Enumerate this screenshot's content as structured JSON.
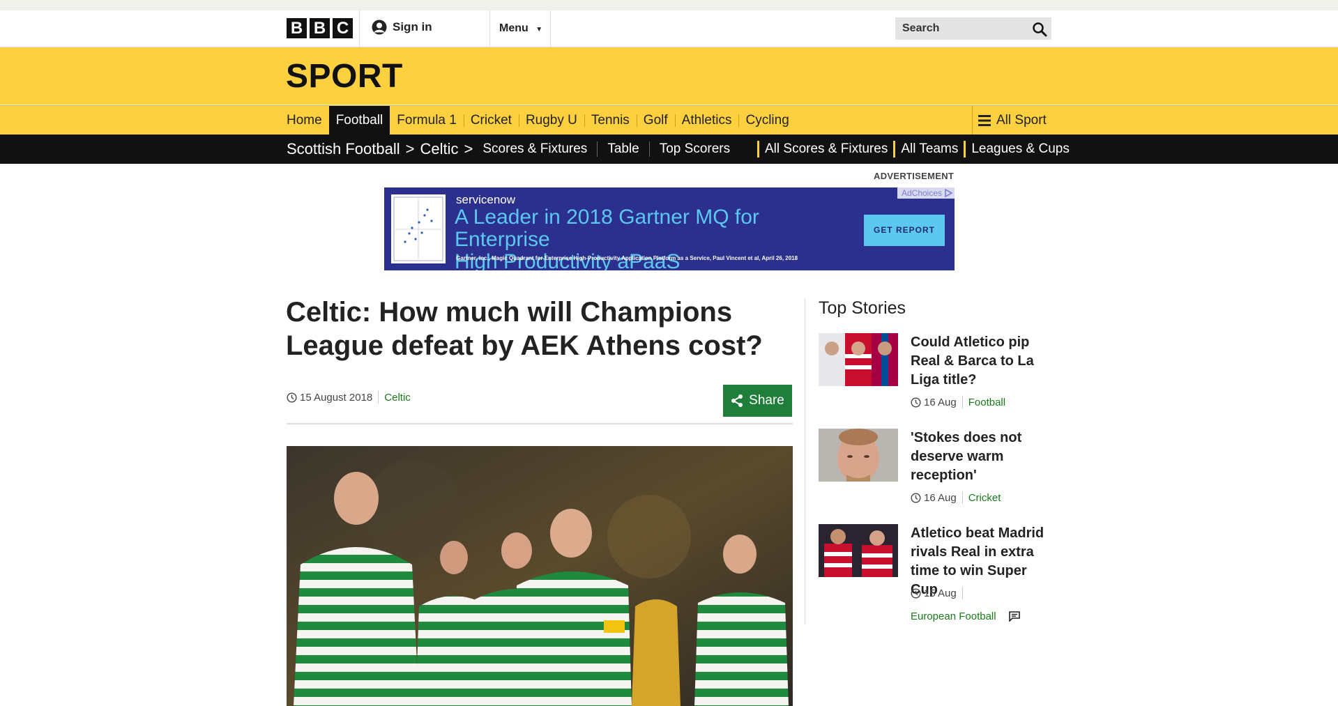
{
  "masthead": {
    "logo": [
      "B",
      "B",
      "C"
    ],
    "signin_label": "Sign in",
    "menu_label": "Menu",
    "search_placeholder": "Search"
  },
  "sport": {
    "title": "SPORT"
  },
  "sport_nav": {
    "items": [
      "Home",
      "Football",
      "Formula 1",
      "Cricket",
      "Rugby U",
      "Tennis",
      "Golf",
      "Athletics",
      "Cycling"
    ],
    "active": "Football",
    "all_sport_label": "All Sport"
  },
  "sub_nav": {
    "breadcrumb": [
      "Scottish Football",
      "Celtic"
    ],
    "links": [
      "Scores & Fixtures",
      "Table",
      "Top Scorers"
    ],
    "right_links": [
      "All Scores & Fixtures",
      "All Teams",
      "Leagues & Cups"
    ]
  },
  "ad": {
    "label": "ADVERTISEMENT",
    "brand": "servicenow",
    "headline_line1": "A Leader in 2018 Gartner MQ for Enterprise",
    "headline_line2": "High Productivity aPaaS",
    "fine_print": "Gartner, Inc., Magic Quadrant for Enterprise High-Productivity Application Platform as a Service, Paul Vincent et al, April 26, 2018",
    "cta": "GET REPORT",
    "adchoices": "AdChoices"
  },
  "article": {
    "headline": "Celtic: How much will Champions League defeat by AEK Athens cost?",
    "date": "15 August 2018",
    "section": "Celtic",
    "share_label": "Share"
  },
  "top_stories": {
    "title": "Top Stories",
    "items": [
      {
        "title": "Could Atletico pip Real & Barca to La Liga title?",
        "date": "16 Aug",
        "section": "Football"
      },
      {
        "title": "'Stokes does not deserve warm reception'",
        "date": "16 Aug",
        "section": "Cricket"
      },
      {
        "title": "Atletico beat Madrid rivals Real in extra time to win Super Cup",
        "date": "15 Aug",
        "section": "European Football"
      }
    ]
  },
  "colors": {
    "sport_yellow": "#fcd03f",
    "nav_black": "#111111",
    "share_green": "#1f7f3a",
    "link_green": "#1a7a1a",
    "ad_navy": "#2b2f8e",
    "ad_cyan": "#5cc8f0"
  },
  "icons": {
    "signin": "user-icon",
    "menu": "caret-down-icon",
    "search": "search-icon",
    "all_sport": "hamburger-icon",
    "clock": "clock-icon",
    "share": "share-icon",
    "comments": "comment-icon"
  }
}
